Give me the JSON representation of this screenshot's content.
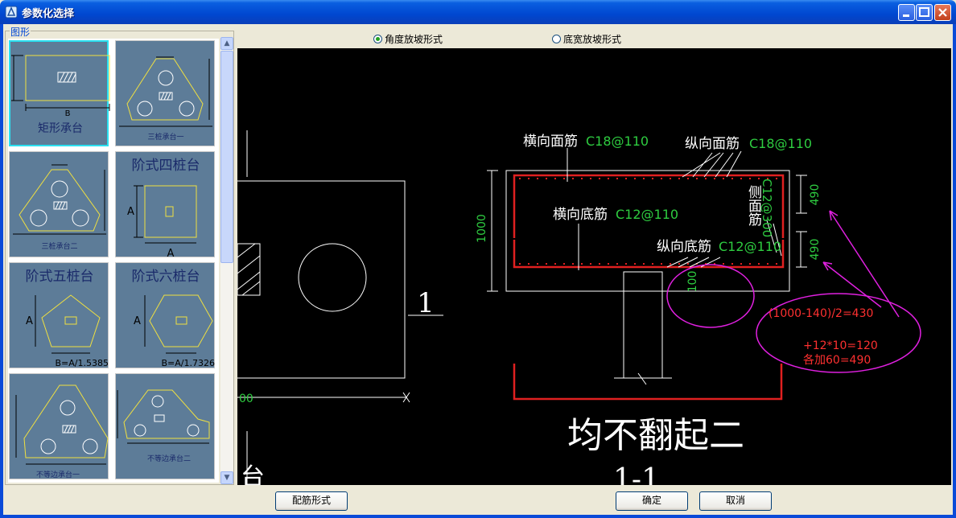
{
  "window": {
    "title": "参数化选择"
  },
  "shapes_group": {
    "label": "图形",
    "items": [
      {
        "label": "矩形承台",
        "dim_text": "B"
      },
      {
        "label": "三桩承台一"
      },
      {
        "label": "三桩承台二"
      },
      {
        "label": "阶式四桩台",
        "dim_text_1": "A",
        "dim_text_2": "A"
      },
      {
        "label": "阶式五桩台",
        "dim_text_1": "A",
        "formula": "B=A/1.5385"
      },
      {
        "label": "阶式六桩台",
        "dim_text_1": "A",
        "formula": "B=A/1.7326"
      },
      {
        "label": "不等边承台一"
      },
      {
        "label": "不等边承台二"
      }
    ]
  },
  "radio_options": [
    {
      "label": "角度放坡形式",
      "selected": true
    },
    {
      "label": "底宽放坡形式",
      "selected": false
    }
  ],
  "drawing": {
    "annotations": {
      "heng_mian": "横向面筋",
      "heng_mian_spec": "C18@110",
      "zong_mian": "纵向面筋",
      "zong_mian_spec": "C18@110",
      "heng_di": "横向底筋",
      "heng_di_spec": "C12@110",
      "zong_di": "纵向底筋",
      "zong_di_spec": "C12@110",
      "ce_mian": "侧面筋",
      "ce_mian_spec": "C12@300",
      "dim_1000": "1000",
      "dim_490_top": "490",
      "dim_490_bottom": "490",
      "dim_100": "100",
      "dim_00": "00",
      "calc_1": "(1000-140)/2=430",
      "calc_2": "+12*10=120",
      "calc_3": "各加60=490",
      "section_mark": "1",
      "heading": "均不翻起二",
      "section_title": "1-1",
      "partial_char": "台"
    }
  },
  "buttons": {
    "rebar_form": "配筋形式",
    "ok": "确定",
    "cancel": "取消"
  },
  "colors": {
    "cad_white": "#ffffff",
    "cad_green": "#2ecc40",
    "cad_red": "#e02020",
    "cad_magenta": "#e020e0",
    "cad_red_text": "#ff3030"
  }
}
